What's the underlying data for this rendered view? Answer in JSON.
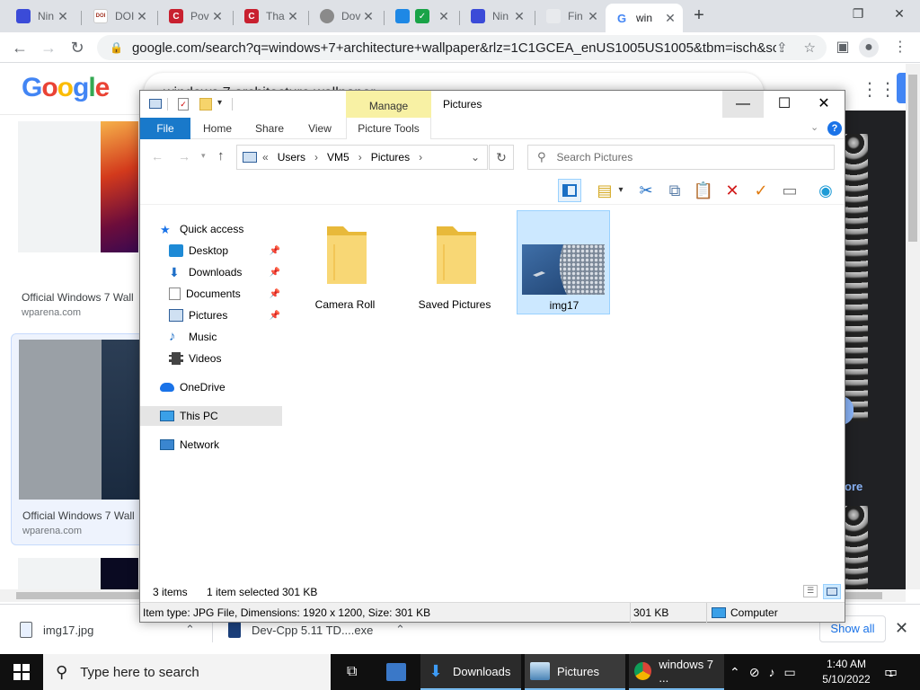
{
  "browser": {
    "tabs": [
      {
        "label": "Nin",
        "icon": "ninja-icon",
        "color": "#3b4bd8"
      },
      {
        "label": "DOI",
        "icon": "doi-icon",
        "color": "#a03020"
      },
      {
        "label": "Pov",
        "icon": "c-icon",
        "color": "#c8202f"
      },
      {
        "label": "Tha",
        "icon": "c-icon",
        "color": "#c8202f"
      },
      {
        "label": "Dov",
        "icon": "apple-icon",
        "color": "#888888"
      },
      {
        "label": "",
        "icon": "image-icon",
        "color": "#1e88e5"
      },
      {
        "label": "Nin",
        "icon": "ninja-icon",
        "color": "#3b4bd8"
      },
      {
        "label": "Fin",
        "icon": "feather-icon",
        "color": "#9aa0a6"
      },
      {
        "label": "win",
        "icon": "google-icon",
        "color": "#4285f4"
      }
    ],
    "url_host": "google.com",
    "url_rest": "/search?q=windows+7+architecture+wallpaper&rlz=1C1GCEA_enUS1005US1005&tbm=isch&sourc..."
  },
  "google": {
    "logo": "Google",
    "query": "windows 7 architecture wallpaper",
    "results": [
      {
        "title": "Official Windows 7 Wall",
        "source": "wparena.com"
      },
      {
        "title": "Official Windows 7 Wall",
        "source": "wparena.com"
      }
    ],
    "more": "ore"
  },
  "downloads": {
    "items": [
      {
        "name": "img17.jpg"
      },
      {
        "name": "Dev-Cpp 5.11 TD....exe"
      }
    ],
    "show_all": "Show all"
  },
  "explorer": {
    "manage_label": "Manage",
    "title": "Pictures",
    "ribbon_tabs": [
      "File",
      "Home",
      "Share",
      "View",
      "Picture Tools"
    ],
    "address": {
      "prefix": "«",
      "crumbs": [
        "Users",
        "VM5",
        "Pictures"
      ]
    },
    "search_placeholder": "Search Pictures",
    "nav": [
      {
        "label": "Quick access",
        "pinned": false
      },
      {
        "label": "Desktop",
        "pinned": true
      },
      {
        "label": "Downloads",
        "pinned": true
      },
      {
        "label": "Documents",
        "pinned": true
      },
      {
        "label": "Pictures",
        "pinned": true
      },
      {
        "label": "Music",
        "pinned": false
      },
      {
        "label": "Videos",
        "pinned": false
      },
      {
        "label": "OneDrive",
        "pinned": false
      },
      {
        "label": "This PC",
        "pinned": false
      },
      {
        "label": "Network",
        "pinned": false
      }
    ],
    "files": [
      {
        "name": "Camera Roll",
        "kind": "folder"
      },
      {
        "name": "Saved Pictures",
        "kind": "folder"
      },
      {
        "name": "img17",
        "kind": "image"
      }
    ],
    "status": {
      "items": "3 items",
      "selected": "1 item selected",
      "size": "301 KB"
    },
    "details": {
      "info": "Item type: JPG File, Dimensions: 1920 x 1200, Size: 301 KB",
      "size": "301 KB",
      "location": "Computer"
    }
  },
  "taskbar": {
    "search_placeholder": "Type here to search",
    "apps": [
      {
        "label": "Downloads"
      },
      {
        "label": "Pictures"
      },
      {
        "label": "windows 7 ..."
      }
    ],
    "time": "1:40 AM",
    "date": "5/10/2022",
    "notifications": "1"
  }
}
